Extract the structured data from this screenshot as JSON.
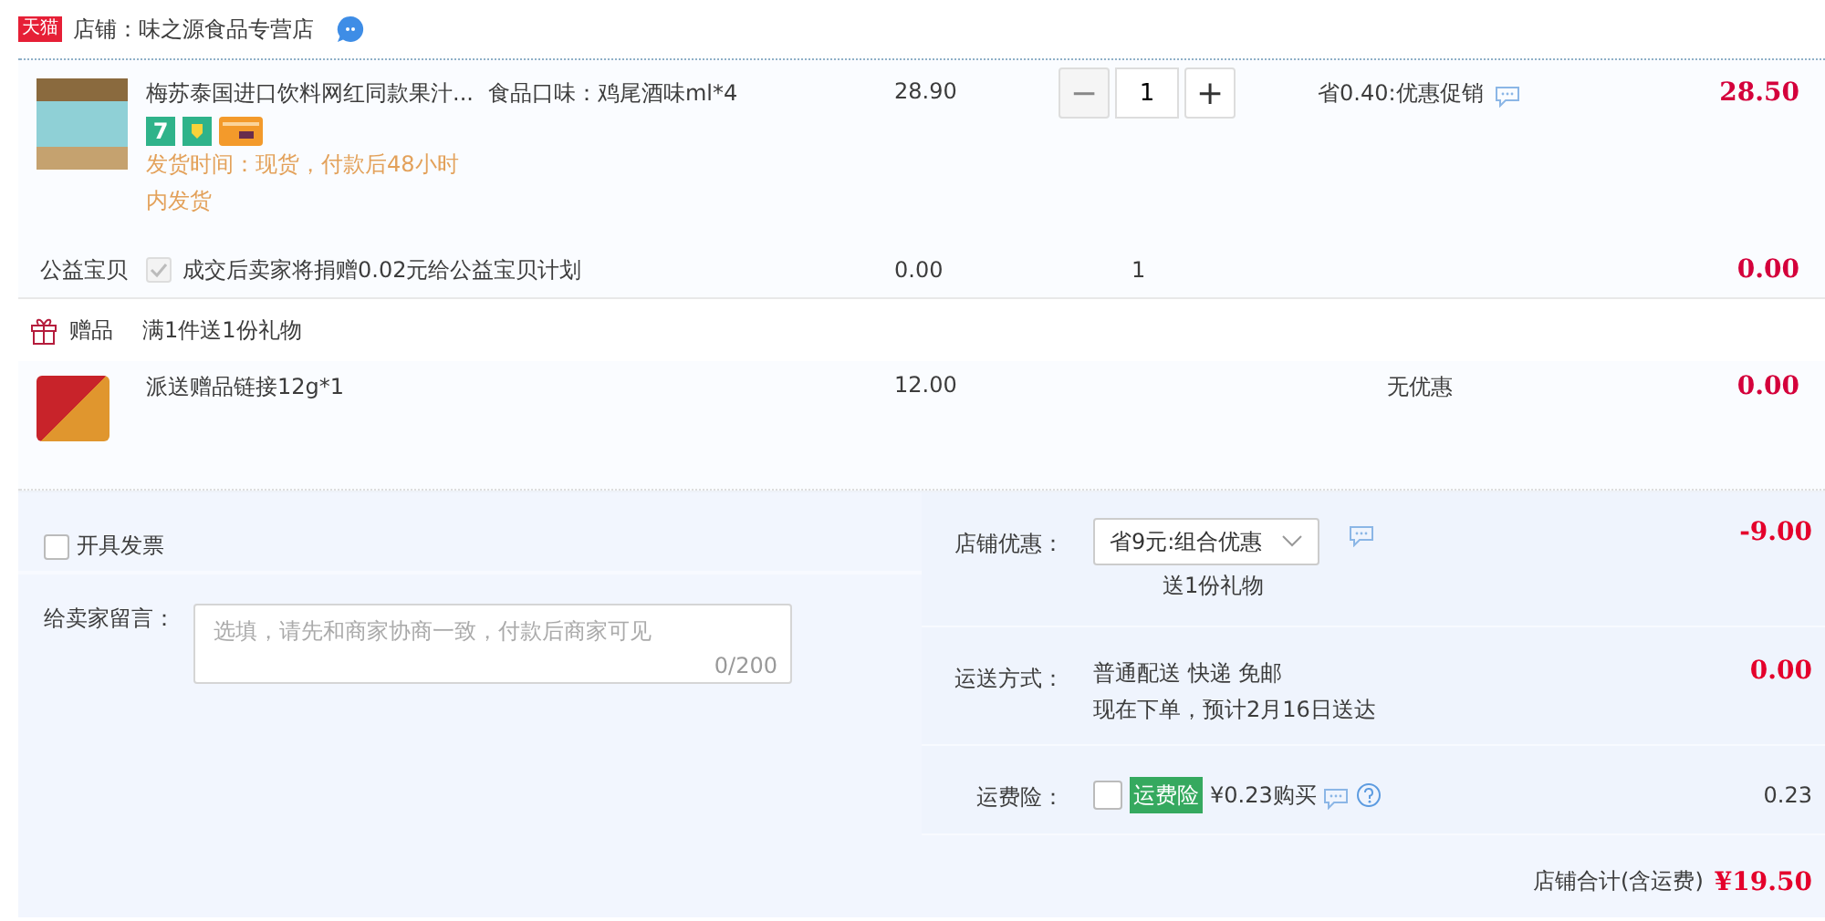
{
  "shop": {
    "badge": "天猫",
    "name": "店铺：味之源食品专营店"
  },
  "item": {
    "title": "梅苏泰国进口饮料网红同款果汁...",
    "sku": "食品口味：鸡尾酒味ml*4",
    "service_badge": "7",
    "delivery": "发货时间：现货，付款后48小时内发货",
    "price": "28.90",
    "minus": "−",
    "quantity": "1",
    "plus": "+",
    "discount": "省0.40:优惠促销",
    "total": "28.50"
  },
  "charity": {
    "label": "公益宝贝",
    "checked": true,
    "text": "成交后卖家将捐赠0.02元给公益宝贝计划",
    "price": "0.00",
    "quantity": "1",
    "total": "0.00"
  },
  "gift": {
    "label": "赠品",
    "condition": "满1件送1份礼物",
    "name": "派送赠品链接12g*1",
    "price": "12.00",
    "discount": "无优惠",
    "total": "0.00"
  },
  "invoice": {
    "label": "开具发票",
    "checked": false
  },
  "message": {
    "label": "给卖家留言：",
    "placeholder": "选填，请先和商家协商一致，付款后商家可见",
    "counter": "0/200"
  },
  "store_discount": {
    "label": "店铺优惠：",
    "value": "省9元:组合优惠",
    "note": "送1份礼物",
    "amount": "-9.00"
  },
  "shipping": {
    "label": "运送方式：",
    "method": "普通配送 快递 免邮",
    "eta": "现在下单，预计2月16日送达",
    "amount": "0.00"
  },
  "insurance": {
    "label": "运费险：",
    "checked": false,
    "tag": "运费险",
    "price": "¥0.23购买",
    "amount": "0.23"
  },
  "total": {
    "label": "店铺合计(含运费)",
    "amount": "¥19.50"
  }
}
